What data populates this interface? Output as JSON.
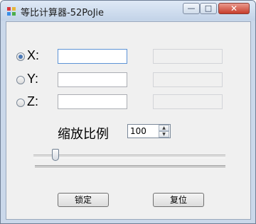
{
  "window": {
    "title": "等比计算器-52PoJie",
    "controls": {
      "minimize": "—",
      "maximize": "□",
      "close": "✕"
    }
  },
  "axes": [
    {
      "label": "X:",
      "selected": true,
      "input_value": "",
      "output_value": ""
    },
    {
      "label": "Y:",
      "selected": false,
      "input_value": "",
      "output_value": ""
    },
    {
      "label": "Z:",
      "selected": false,
      "input_value": "",
      "output_value": ""
    }
  ],
  "scale": {
    "label": "缩放比例",
    "value": "100",
    "spin_up": "▲",
    "spin_down": "▼"
  },
  "slider": {
    "value_fraction": 0.1
  },
  "buttons": {
    "lock": "锁定",
    "reset": "复位"
  },
  "colors": {
    "accent": "#4a78b6",
    "close_button": "#c63c2b"
  },
  "icons": {
    "app": "calculator-app-icon"
  }
}
